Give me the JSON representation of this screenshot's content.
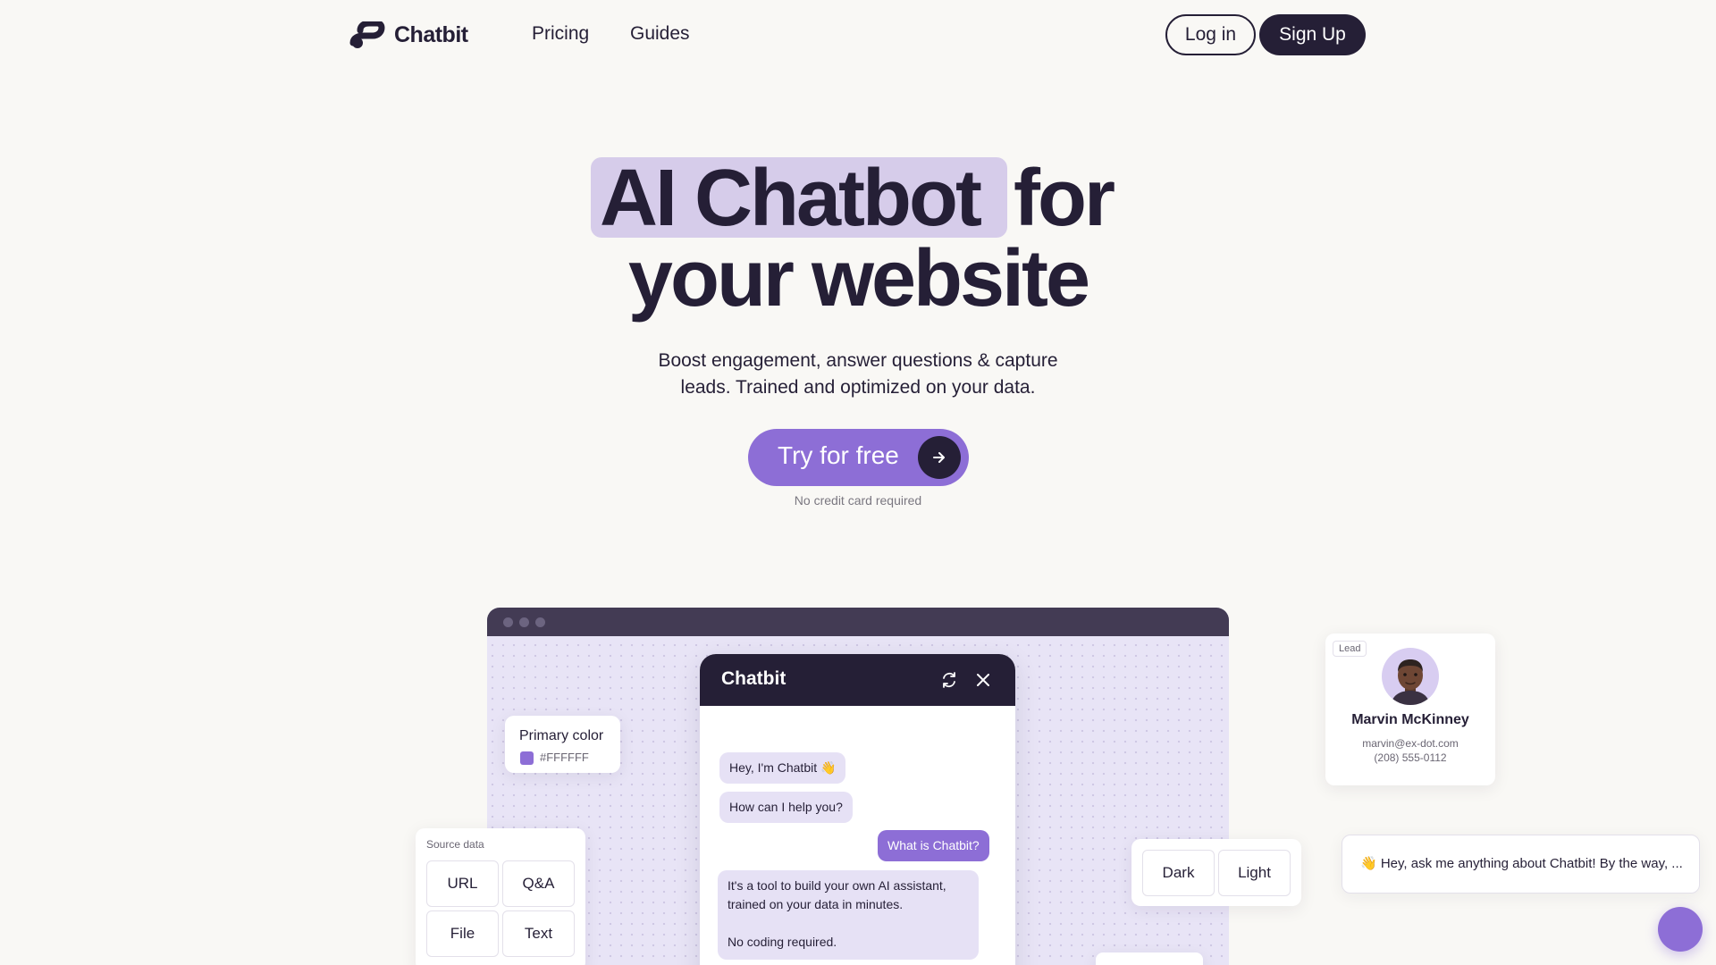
{
  "nav": {
    "logo": "Chatbit",
    "links": [
      "Pricing",
      "Guides"
    ],
    "login": "Log in",
    "signup": "Sign Up"
  },
  "hero": {
    "highlight": "AI Chatbot",
    "line1_rest": "for",
    "line2": "your website",
    "subtitle_line1": "Boost engagement, answer questions & capture",
    "subtitle_line2": "leads. Trained and optimized on your data.",
    "cta": "Try for free",
    "cta_note": "No credit card required"
  },
  "demo": {
    "chat": {
      "title": "Chatbit",
      "messages": [
        {
          "from": "bot",
          "text": "Hey, I'm Chatbit 👋"
        },
        {
          "from": "bot",
          "text": "How can I help you?"
        },
        {
          "from": "user",
          "text": "What is Chatbit?"
        },
        {
          "from": "bot",
          "line1": "It's a tool to build your own AI assistant,",
          "line2": "trained on your data in minutes.",
          "line3": "No coding required."
        }
      ]
    },
    "primary_color": {
      "label": "Primary color",
      "value": "#FFFFFF"
    },
    "source_data": {
      "label": "Source data",
      "options": [
        "URL",
        "Q&A",
        "File",
        "Text"
      ]
    },
    "theme": {
      "options": [
        "Dark",
        "Light"
      ]
    },
    "lead": {
      "badge": "Lead",
      "name": "Marvin McKinney",
      "email": "marvin@ex-dot.com",
      "phone": "(208) 555-0112"
    },
    "greeting": "👋 Hey, ask me anything about Chatbit! By the way, ..."
  },
  "colors": {
    "brand_dark": "#251f36",
    "accent_purple": "#8d6ed6",
    "highlight": "#d6ccea",
    "background": "#f9f8f5"
  }
}
